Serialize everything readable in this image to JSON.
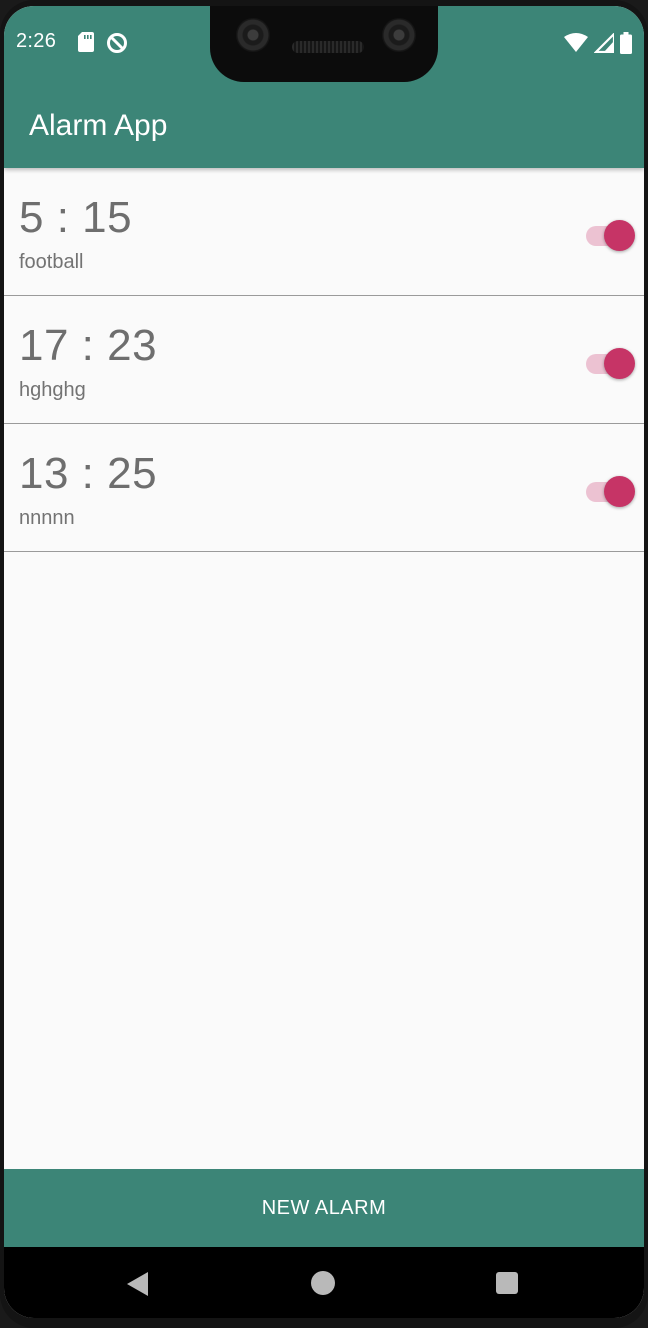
{
  "status_bar": {
    "time": "2:26",
    "left_icons": [
      "sd-card-icon",
      "data-saver-icon"
    ],
    "right_icons": [
      "wifi-icon",
      "cellular-signal-icon",
      "battery-icon"
    ]
  },
  "app_bar": {
    "title": "Alarm App",
    "color": "#3c8577"
  },
  "alarms": [
    {
      "time": "5 : 15",
      "label": "football",
      "enabled": true
    },
    {
      "time": "17 : 23",
      "label": "hghghg",
      "enabled": true
    },
    {
      "time": "13 : 25",
      "label": "nnnnn",
      "enabled": true
    }
  ],
  "switch_colors": {
    "thumb": "#c63466",
    "track": "#ecc2d2"
  },
  "new_alarm_button": {
    "label": "NEW ALARM"
  },
  "nav_bar": {
    "icons": [
      "back-icon",
      "home-icon",
      "recents-icon"
    ]
  }
}
